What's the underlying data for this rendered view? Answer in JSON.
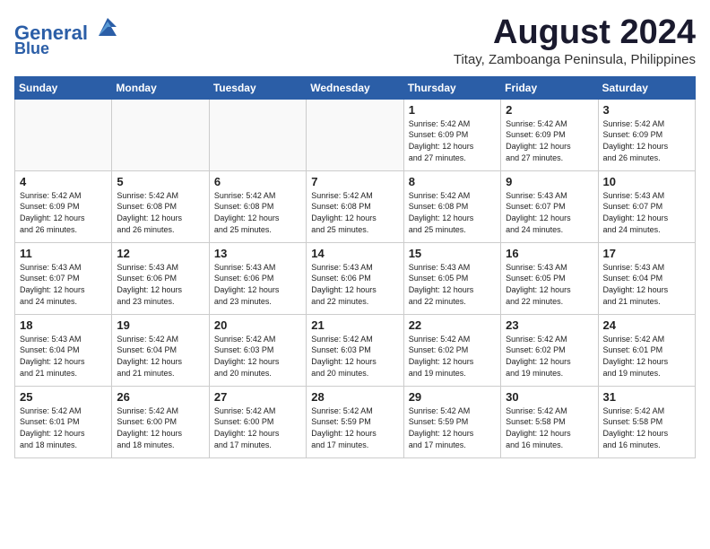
{
  "header": {
    "logo_line1": "General",
    "logo_line2": "Blue",
    "title": "August 2024",
    "subtitle": "Titay, Zamboanga Peninsula, Philippines"
  },
  "days_of_week": [
    "Sunday",
    "Monday",
    "Tuesday",
    "Wednesday",
    "Thursday",
    "Friday",
    "Saturday"
  ],
  "weeks": [
    [
      {
        "day": "",
        "text": ""
      },
      {
        "day": "",
        "text": ""
      },
      {
        "day": "",
        "text": ""
      },
      {
        "day": "",
        "text": ""
      },
      {
        "day": "1",
        "text": "Sunrise: 5:42 AM\nSunset: 6:09 PM\nDaylight: 12 hours\nand 27 minutes."
      },
      {
        "day": "2",
        "text": "Sunrise: 5:42 AM\nSunset: 6:09 PM\nDaylight: 12 hours\nand 27 minutes."
      },
      {
        "day": "3",
        "text": "Sunrise: 5:42 AM\nSunset: 6:09 PM\nDaylight: 12 hours\nand 26 minutes."
      }
    ],
    [
      {
        "day": "4",
        "text": "Sunrise: 5:42 AM\nSunset: 6:09 PM\nDaylight: 12 hours\nand 26 minutes."
      },
      {
        "day": "5",
        "text": "Sunrise: 5:42 AM\nSunset: 6:08 PM\nDaylight: 12 hours\nand 26 minutes."
      },
      {
        "day": "6",
        "text": "Sunrise: 5:42 AM\nSunset: 6:08 PM\nDaylight: 12 hours\nand 25 minutes."
      },
      {
        "day": "7",
        "text": "Sunrise: 5:42 AM\nSunset: 6:08 PM\nDaylight: 12 hours\nand 25 minutes."
      },
      {
        "day": "8",
        "text": "Sunrise: 5:42 AM\nSunset: 6:08 PM\nDaylight: 12 hours\nand 25 minutes."
      },
      {
        "day": "9",
        "text": "Sunrise: 5:43 AM\nSunset: 6:07 PM\nDaylight: 12 hours\nand 24 minutes."
      },
      {
        "day": "10",
        "text": "Sunrise: 5:43 AM\nSunset: 6:07 PM\nDaylight: 12 hours\nand 24 minutes."
      }
    ],
    [
      {
        "day": "11",
        "text": "Sunrise: 5:43 AM\nSunset: 6:07 PM\nDaylight: 12 hours\nand 24 minutes."
      },
      {
        "day": "12",
        "text": "Sunrise: 5:43 AM\nSunset: 6:06 PM\nDaylight: 12 hours\nand 23 minutes."
      },
      {
        "day": "13",
        "text": "Sunrise: 5:43 AM\nSunset: 6:06 PM\nDaylight: 12 hours\nand 23 minutes."
      },
      {
        "day": "14",
        "text": "Sunrise: 5:43 AM\nSunset: 6:06 PM\nDaylight: 12 hours\nand 22 minutes."
      },
      {
        "day": "15",
        "text": "Sunrise: 5:43 AM\nSunset: 6:05 PM\nDaylight: 12 hours\nand 22 minutes."
      },
      {
        "day": "16",
        "text": "Sunrise: 5:43 AM\nSunset: 6:05 PM\nDaylight: 12 hours\nand 22 minutes."
      },
      {
        "day": "17",
        "text": "Sunrise: 5:43 AM\nSunset: 6:04 PM\nDaylight: 12 hours\nand 21 minutes."
      }
    ],
    [
      {
        "day": "18",
        "text": "Sunrise: 5:43 AM\nSunset: 6:04 PM\nDaylight: 12 hours\nand 21 minutes."
      },
      {
        "day": "19",
        "text": "Sunrise: 5:42 AM\nSunset: 6:04 PM\nDaylight: 12 hours\nand 21 minutes."
      },
      {
        "day": "20",
        "text": "Sunrise: 5:42 AM\nSunset: 6:03 PM\nDaylight: 12 hours\nand 20 minutes."
      },
      {
        "day": "21",
        "text": "Sunrise: 5:42 AM\nSunset: 6:03 PM\nDaylight: 12 hours\nand 20 minutes."
      },
      {
        "day": "22",
        "text": "Sunrise: 5:42 AM\nSunset: 6:02 PM\nDaylight: 12 hours\nand 19 minutes."
      },
      {
        "day": "23",
        "text": "Sunrise: 5:42 AM\nSunset: 6:02 PM\nDaylight: 12 hours\nand 19 minutes."
      },
      {
        "day": "24",
        "text": "Sunrise: 5:42 AM\nSunset: 6:01 PM\nDaylight: 12 hours\nand 19 minutes."
      }
    ],
    [
      {
        "day": "25",
        "text": "Sunrise: 5:42 AM\nSunset: 6:01 PM\nDaylight: 12 hours\nand 18 minutes."
      },
      {
        "day": "26",
        "text": "Sunrise: 5:42 AM\nSunset: 6:00 PM\nDaylight: 12 hours\nand 18 minutes."
      },
      {
        "day": "27",
        "text": "Sunrise: 5:42 AM\nSunset: 6:00 PM\nDaylight: 12 hours\nand 17 minutes."
      },
      {
        "day": "28",
        "text": "Sunrise: 5:42 AM\nSunset: 5:59 PM\nDaylight: 12 hours\nand 17 minutes."
      },
      {
        "day": "29",
        "text": "Sunrise: 5:42 AM\nSunset: 5:59 PM\nDaylight: 12 hours\nand 17 minutes."
      },
      {
        "day": "30",
        "text": "Sunrise: 5:42 AM\nSunset: 5:58 PM\nDaylight: 12 hours\nand 16 minutes."
      },
      {
        "day": "31",
        "text": "Sunrise: 5:42 AM\nSunset: 5:58 PM\nDaylight: 12 hours\nand 16 minutes."
      }
    ]
  ]
}
